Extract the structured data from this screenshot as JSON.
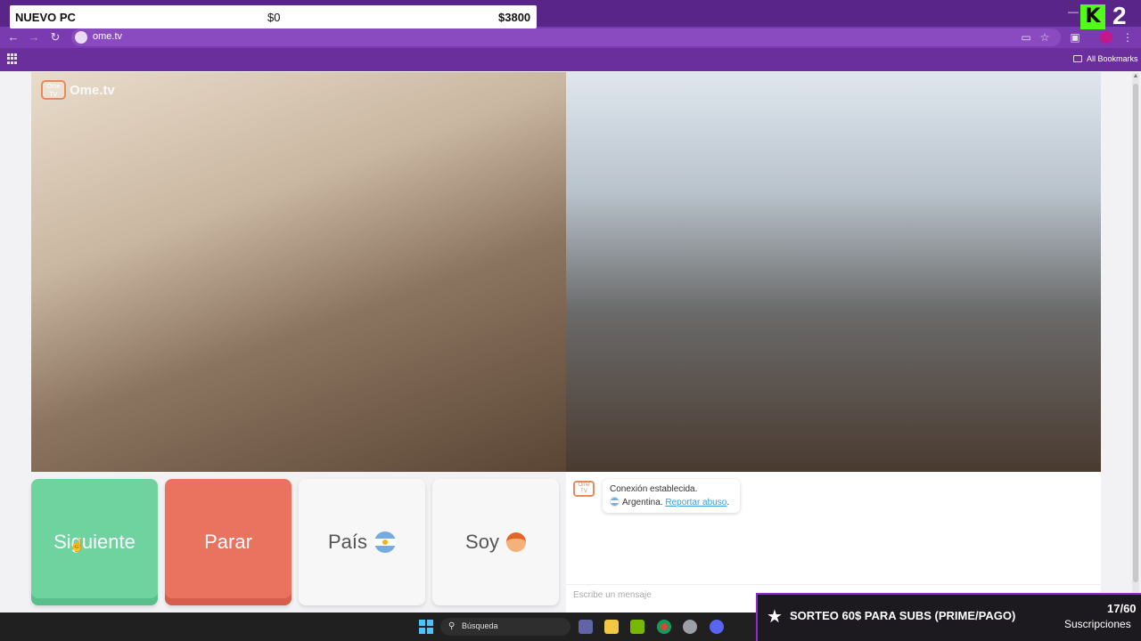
{
  "overlay": {
    "goal_label": "NUEVO PC",
    "current_amount": "$0",
    "target_amount": "$3800",
    "kick_number": "2"
  },
  "browser": {
    "url": "ome.tv",
    "bookmarks_label": "All Bookmarks"
  },
  "site": {
    "logo_text": "Ome.tv",
    "logo_badge": "Ome TV"
  },
  "controls": {
    "next": "Siguiente",
    "stop": "Parar",
    "country": "País",
    "gender": "Soy"
  },
  "chat": {
    "status": "Conexión establecida.",
    "country": "Argentina.",
    "report": "Reportar abuso",
    "report_suffix": ".",
    "input_placeholder": "Escribe un mensaje"
  },
  "stream": {
    "sorteo_text": "SORTEO 60$ PARA SUBS (PRIME/PAGO)",
    "sub_count": "17/60",
    "sub_label": "Suscripciones"
  },
  "taskbar": {
    "search_placeholder": "Búsqueda"
  },
  "colors": {
    "browser_theme": "#6a2f9c",
    "next_button": "#6fd3a0",
    "stop_button": "#e9735e",
    "kick_green": "#53fc18"
  }
}
